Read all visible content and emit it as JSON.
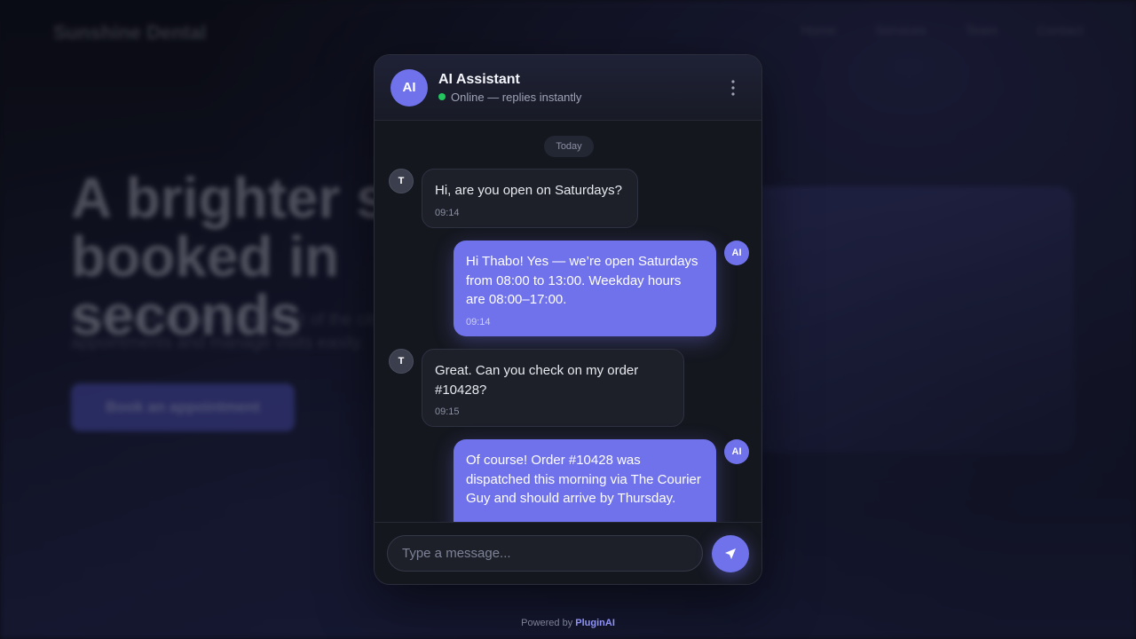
{
  "background": {
    "logo": "Sunshine Dental",
    "nav": [
      "Home",
      "Services",
      "Team",
      "Contact"
    ],
    "hero": "A brighter smile, booked in seconds",
    "sub": "Modern dental care in the heart of the city. Book appointments and manage visits easily.",
    "cta": "Book an appointment"
  },
  "chat": {
    "avatar": "AI",
    "title": "AI Assistant",
    "status": "Online — replies instantly",
    "menu_icon": "more-vertical-icon",
    "date_divider": "Today",
    "messages": [
      {
        "from": "user",
        "avatar": "T",
        "text": "Hi, are you open on Saturdays?",
        "time": "09:14"
      },
      {
        "from": "ai",
        "avatar": "AI",
        "text": "Hi Thabo! Yes — we’re open Saturdays from 08:00 to 13:00. Weekday hours are 08:00–17:00.",
        "time": "09:14"
      },
      {
        "from": "user",
        "avatar": "T",
        "text": "Great. Can you check on my order #10428?",
        "time": "09:15"
      },
      {
        "from": "ai",
        "avatar": "AI",
        "text": "Of course! Order #10428 was dispatched this morning via The Courier Guy and should arrive by Thursday.",
        "time": ""
      }
    ],
    "input_placeholder": "Type a message...",
    "send_icon": "send-icon"
  },
  "footer": {
    "prefix": "Powered by",
    "brand": "PluginAI"
  },
  "colors": {
    "accent": "#6f72ea",
    "online": "#22c55e",
    "panel": "#15171f"
  }
}
